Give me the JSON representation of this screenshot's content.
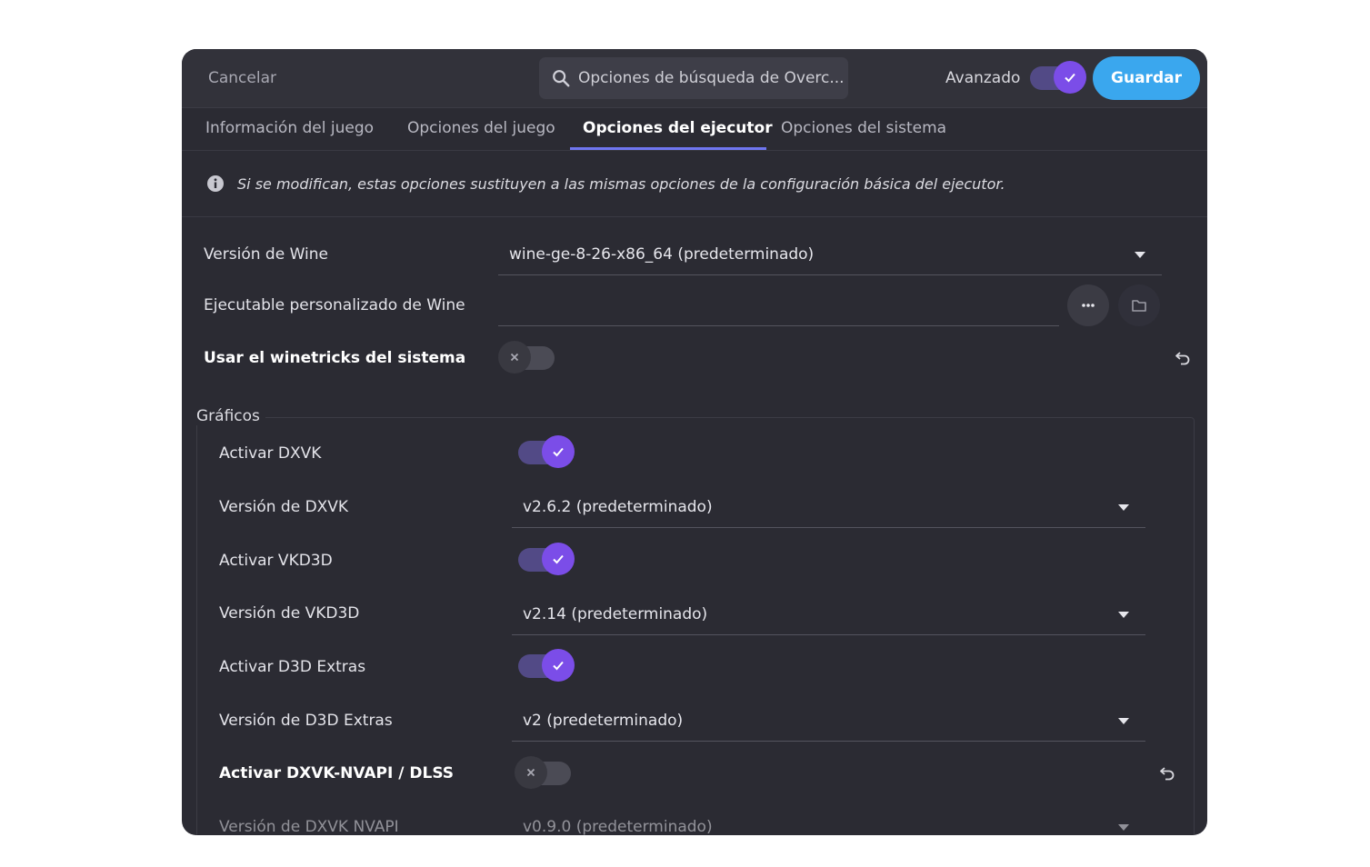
{
  "header": {
    "cancel_label": "Cancelar",
    "search_placeholder": "Opciones de búsqueda de Overc...",
    "advanced_label": "Avanzado",
    "advanced_on": true,
    "save_label": "Guardar"
  },
  "tabs": [
    {
      "label": "Información del juego",
      "active": false
    },
    {
      "label": "Opciones del juego",
      "active": false
    },
    {
      "label": "Opciones del ejecutor",
      "active": true
    },
    {
      "label": "Opciones del sistema",
      "active": false
    }
  ],
  "info": {
    "icon": "info-icon",
    "text": "Si se modifican, estas opciones sustituyen a las mismas opciones de la configuración básica del ejecutor."
  },
  "runner": {
    "wine_version_label": "Versión de Wine",
    "wine_version_value": "wine-ge-8-26-x86_64 (predeterminado)",
    "custom_exe_label": "Ejecutable personalizado de Wine",
    "custom_exe_value": "",
    "winetricks_label": "Usar el winetricks del sistema",
    "winetricks_on": false
  },
  "graphics": {
    "title": "Gráficos",
    "dxvk_label": "Activar DXVK",
    "dxvk_on": true,
    "dxvk_version_label": "Versión de DXVK",
    "dxvk_version_value": "v2.6.2 (predeterminado)",
    "vkd3d_label": "Activar VKD3D",
    "vkd3d_on": true,
    "vkd3d_version_label": "Versión de VKD3D",
    "vkd3d_version_value": "v2.14 (predeterminado)",
    "d3d_extras_label": "Activar D3D Extras",
    "d3d_extras_on": true,
    "d3d_extras_version_label": "Versión de D3D Extras",
    "d3d_extras_version_value": "v2 (predeterminado)",
    "nvapi_label": "Activar DXVK-NVAPI / DLSS",
    "nvapi_on": false,
    "nvapi_version_label": "Versión de DXVK NVAPI",
    "nvapi_version_value": "v0.9.0 (predeterminado)"
  },
  "colors": {
    "accent": "#7b4de8",
    "save": "#3aa7ee",
    "tab_underline": "#6f76f0",
    "background": "#2b2b33"
  }
}
